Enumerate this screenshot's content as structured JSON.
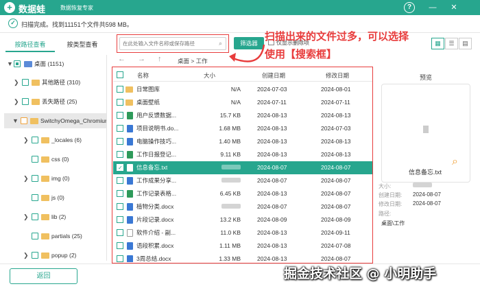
{
  "titlebar": {
    "logo_char": "+",
    "app_name": "数据蛙",
    "slogan": "数据恢复专家",
    "help": "?",
    "minimize": "—",
    "close": "✕"
  },
  "status": {
    "icon": "✓",
    "text": "扫描完成。找到11151个文件共598 MB。"
  },
  "tabs": [
    {
      "label": "按路径查看"
    },
    {
      "label": "按类型查看"
    }
  ],
  "tree": [
    {
      "label": "桌面 (1151)",
      "arrow": "▼"
    },
    {
      "label": "其他路径 (310)",
      "arrow": "❯"
    },
    {
      "label": "丢失路径 (25)",
      "arrow": "❯"
    },
    {
      "label": "SwitchyOmega_Chromium",
      "arrow": "▼"
    },
    {
      "label": "_locales (6)",
      "arrow": "❯"
    },
    {
      "label": "css (0)",
      "arrow": ""
    },
    {
      "label": "img (0)",
      "arrow": "❯"
    },
    {
      "label": "js (0)",
      "arrow": ""
    },
    {
      "label": "lib (2)",
      "arrow": "❯"
    },
    {
      "label": "partials (25)",
      "arrow": ""
    },
    {
      "label": "popup (2)",
      "arrow": "❯"
    }
  ],
  "search": {
    "placeholder": "在此处输入文件名称或保存路径",
    "icon": "⌕"
  },
  "filter_button": "筛选器",
  "only_deleted": "仅显示删除项",
  "annotation": "扫描出来的文件过多，可以选择使用【搜索框】",
  "view_buttons": [
    "▦",
    "☰",
    "▤"
  ],
  "nav": {
    "back": "←",
    "forward": "→",
    "up": "↑",
    "breadcrumb": "桌面 > 工作"
  },
  "table": {
    "headers": {
      "name": "名称",
      "size": "大小",
      "created": "创建日期",
      "modified": "修改日期"
    },
    "rows": [
      {
        "name": "日常图库",
        "size": "N/A",
        "created": "2024-07-03",
        "modified": "2024-08-01"
      },
      {
        "name": "桌面壁纸",
        "size": "N/A",
        "created": "2024-07-11",
        "modified": "2024-07-11"
      },
      {
        "name": "用户反馈数据...",
        "size": "15.7 KB",
        "created": "2024-08-13",
        "modified": "2024-08-13"
      },
      {
        "name": "项目说明书.do...",
        "size": "1.68 MB",
        "created": "2024-08-13",
        "modified": "2024-07-03"
      },
      {
        "name": "电脑操作技巧...",
        "size": "1.40 MB",
        "created": "2024-08-13",
        "modified": "2024-08-13"
      },
      {
        "name": "工作日报登记...",
        "size": "9.11 KB",
        "created": "2024-08-13",
        "modified": "2024-08-13"
      },
      {
        "name": "信息备忘.txt",
        "size": "",
        "created": "2024-08-07",
        "modified": "2024-08-07"
      },
      {
        "name": "工作成果分享...",
        "size": "",
        "created": "2024-08-07",
        "modified": "2024-08-07"
      },
      {
        "name": "工作记录表格...",
        "size": "6.45 KB",
        "created": "2024-08-13",
        "modified": "2024-08-07"
      },
      {
        "name": "植物分类.docx",
        "size": "",
        "created": "2024-08-07",
        "modified": "2024-08-07"
      },
      {
        "name": "片段记录.docx",
        "size": "13.2 KB",
        "created": "2024-08-09",
        "modified": "2024-08-09"
      },
      {
        "name": "软件介绍 - 副...",
        "size": "11.0 KB",
        "created": "2024-08-13",
        "modified": "2024-09-11"
      },
      {
        "name": "语段积累.docx",
        "size": "1.11 MB",
        "created": "2024-08-13",
        "modified": "2024-07-08"
      },
      {
        "name": "3周总结.docx",
        "size": "1.33 MB",
        "created": "2024-08-13",
        "modified": "2024-08-07"
      }
    ]
  },
  "preview": {
    "title": "预览",
    "filename": "信息备忘.txt",
    "size_label": "大小:",
    "created_label": "创建日期:",
    "modified_label": "修改日期:",
    "path_label": "路径:",
    "created": "2024-08-07",
    "modified": "2024-08-07",
    "path": "桌面\\工作",
    "zoom_icon": "⌕"
  },
  "back_button": "返回",
  "watermark": "掘金技术社区 @ 小明助手"
}
